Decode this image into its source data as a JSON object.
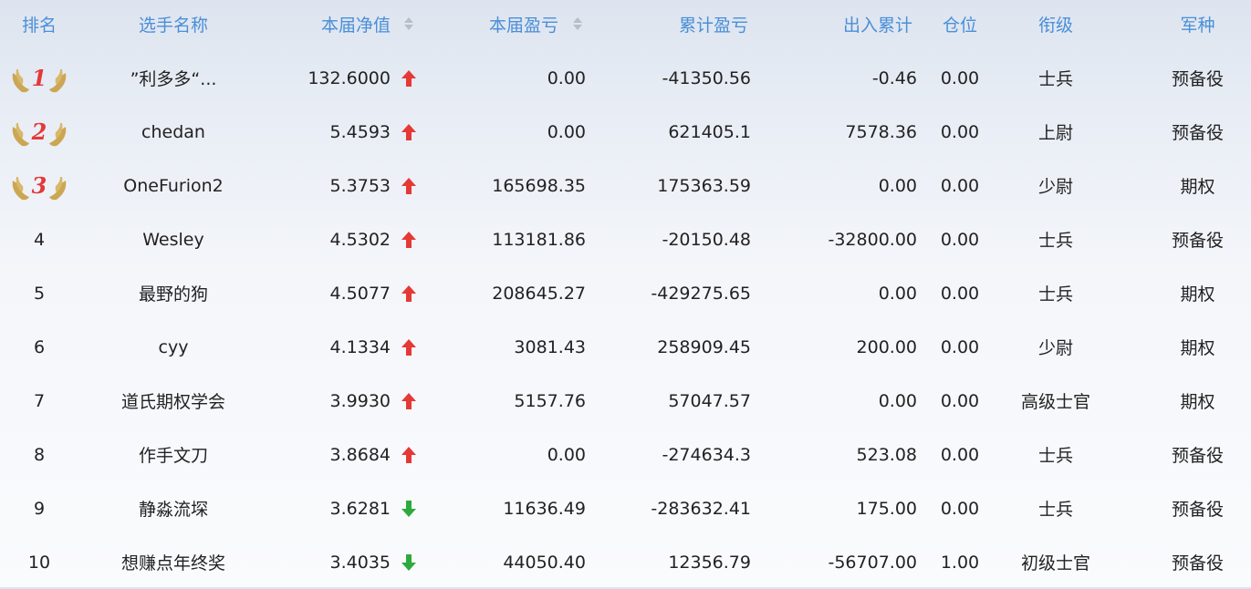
{
  "colors": {
    "header_text": "#4a8fd8",
    "up_arrow": "#e53935",
    "down_arrow": "#2eaa3c",
    "medal_gold": "#c9a24a",
    "medal_number": "#e23a3a"
  },
  "header": {
    "rank": "排名",
    "name": "选手名称",
    "nav": "本届净值",
    "pnl": "本届盈亏",
    "cum_pnl": "累计盈亏",
    "flow": "出入累计",
    "position": "仓位",
    "title": "衔级",
    "type": "军种"
  },
  "rows": [
    {
      "rank": "1",
      "medal": "1",
      "name": "”利多多“...",
      "nav": "132.6000",
      "trend": "up",
      "pnl": "0.00",
      "cum_pnl": "-41350.56",
      "flow": "-0.46",
      "position": "0.00",
      "title": "士兵",
      "type": "预备役"
    },
    {
      "rank": "2",
      "medal": "2",
      "name": "chedan",
      "nav": "5.4593",
      "trend": "up",
      "pnl": "0.00",
      "cum_pnl": "621405.1",
      "flow": "7578.36",
      "position": "0.00",
      "title": "上尉",
      "type": "预备役"
    },
    {
      "rank": "3",
      "medal": "3",
      "name": "OneFurion2",
      "nav": "5.3753",
      "trend": "up",
      "pnl": "165698.35",
      "cum_pnl": "175363.59",
      "flow": "0.00",
      "position": "0.00",
      "title": "少尉",
      "type": "期权"
    },
    {
      "rank": "4",
      "medal": "",
      "name": "Wesley",
      "nav": "4.5302",
      "trend": "up",
      "pnl": "113181.86",
      "cum_pnl": "-20150.48",
      "flow": "-32800.00",
      "position": "0.00",
      "title": "士兵",
      "type": "预备役"
    },
    {
      "rank": "5",
      "medal": "",
      "name": "最野的狗",
      "nav": "4.5077",
      "trend": "up",
      "pnl": "208645.27",
      "cum_pnl": "-429275.65",
      "flow": "0.00",
      "position": "0.00",
      "title": "士兵",
      "type": "期权"
    },
    {
      "rank": "6",
      "medal": "",
      "name": "cyy",
      "nav": "4.1334",
      "trend": "up",
      "pnl": "3081.43",
      "cum_pnl": "258909.45",
      "flow": "200.00",
      "position": "0.00",
      "title": "少尉",
      "type": "期权"
    },
    {
      "rank": "7",
      "medal": "",
      "name": "道氏期权学会",
      "nav": "3.9930",
      "trend": "up",
      "pnl": "5157.76",
      "cum_pnl": "57047.57",
      "flow": "0.00",
      "position": "0.00",
      "title": "高级士官",
      "type": "期权"
    },
    {
      "rank": "8",
      "medal": "",
      "name": "作手文刀",
      "nav": "3.8684",
      "trend": "up",
      "pnl": "0.00",
      "cum_pnl": "-274634.3",
      "flow": "523.08",
      "position": "0.00",
      "title": "士兵",
      "type": "预备役"
    },
    {
      "rank": "9",
      "medal": "",
      "name": "静淼流堔",
      "nav": "3.6281",
      "trend": "down",
      "pnl": "11636.49",
      "cum_pnl": "-283632.41",
      "flow": "175.00",
      "position": "0.00",
      "title": "士兵",
      "type": "预备役"
    },
    {
      "rank": "10",
      "medal": "",
      "name": "想赚点年终奖",
      "nav": "3.4035",
      "trend": "down",
      "pnl": "44050.40",
      "cum_pnl": "12356.79",
      "flow": "-56707.00",
      "position": "1.00",
      "title": "初级士官",
      "type": "预备役"
    }
  ]
}
